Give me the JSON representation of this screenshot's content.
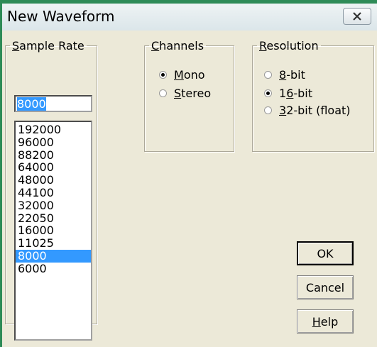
{
  "window": {
    "title": "New Waveform"
  },
  "sample_rate": {
    "legend": "Sample Rate",
    "input_value": "8000",
    "options": [
      "192000",
      "96000",
      "88200",
      "64000",
      "48000",
      "44100",
      "32000",
      "22050",
      "16000",
      "11025",
      "8000",
      "6000"
    ],
    "selected": "8000"
  },
  "channels": {
    "legend": "Channels",
    "options": [
      {
        "label": "Mono",
        "checked": true
      },
      {
        "label": "Stereo",
        "checked": false
      }
    ]
  },
  "resolution": {
    "legend": "Resolution",
    "options": [
      {
        "label": "8-bit",
        "checked": false
      },
      {
        "label": "16-bit",
        "checked": true
      },
      {
        "label": "32-bit (float)",
        "checked": false
      }
    ]
  },
  "buttons": {
    "ok": "OK",
    "cancel": "Cancel",
    "help": "Help"
  },
  "colors": {
    "selection": "#3399ff",
    "frame_accent": "#2e8b57"
  }
}
